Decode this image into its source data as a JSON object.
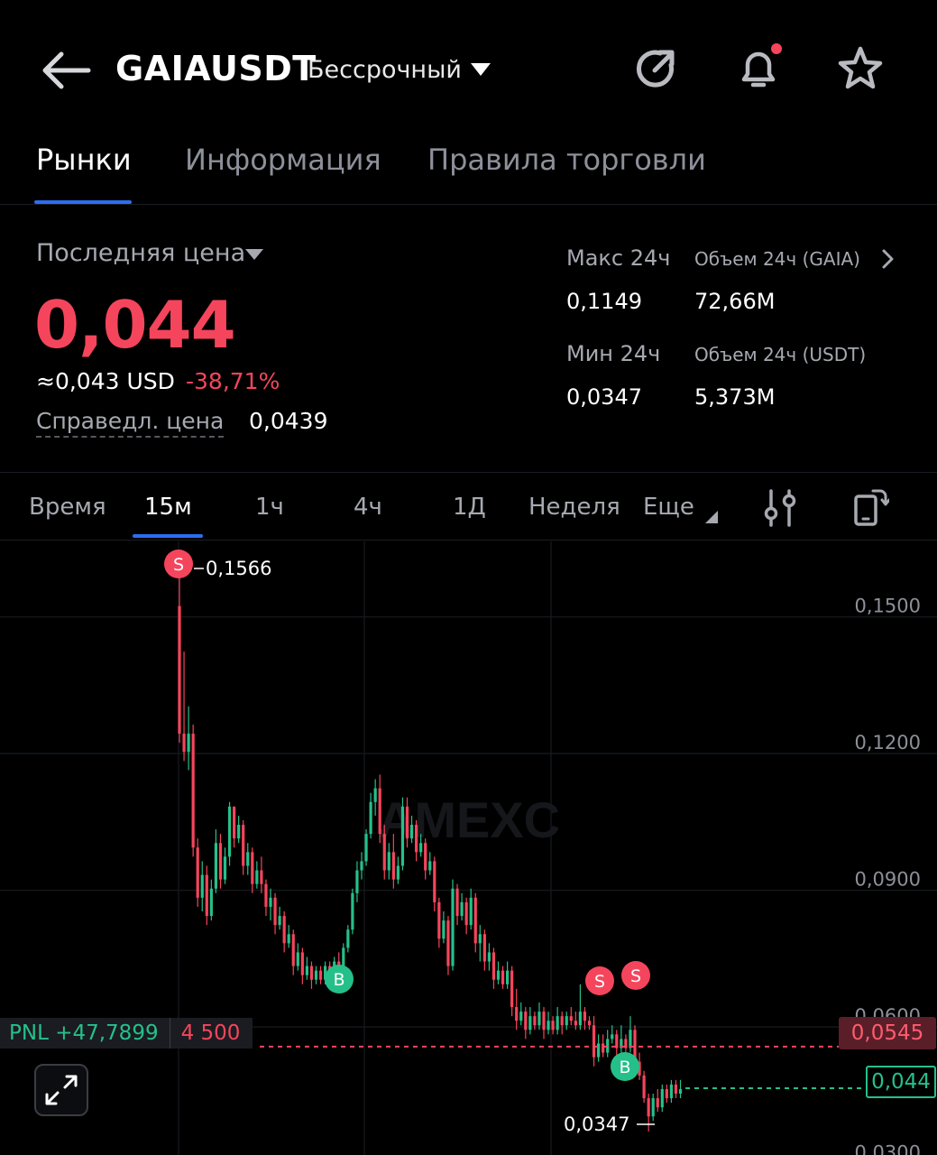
{
  "header": {
    "title": "GAIAUSDT",
    "subtitle": "Бессрочный"
  },
  "tabs": [
    {
      "label": "Рынки",
      "active": true
    },
    {
      "label": "Информация",
      "active": false
    },
    {
      "label": "Правила торговли",
      "active": false
    }
  ],
  "stats": {
    "last_price_label": "Последняя цена",
    "last_price": "0,044",
    "usd_equiv": "≈0,043 USD",
    "change": "-38,71%",
    "fair_label": "Справедл. цена",
    "fair_value": "0,0439",
    "high_label": "Макс 24ч",
    "high_value": "0,1149",
    "low_label": "Мин 24ч",
    "low_value": "0,0347",
    "vol_gaia_label": "Объем 24ч (GAIA)",
    "vol_gaia_value": "72,66M",
    "vol_usdt_label": "Объем 24ч  (USDT)",
    "vol_usdt_value": "5,373M"
  },
  "timeframes": [
    {
      "label": "Время",
      "active": false
    },
    {
      "label": "15м",
      "active": true
    },
    {
      "label": "1ч",
      "active": false
    },
    {
      "label": "4ч",
      "active": false
    },
    {
      "label": "1Д",
      "active": false
    },
    {
      "label": "Неделя",
      "active": false
    },
    {
      "label": "Еще",
      "active": false
    }
  ],
  "colors": {
    "up": "#25c08a",
    "down": "#f5455c",
    "accent": "#2c6ef2"
  },
  "chart_data": {
    "type": "candlestick",
    "y_ticks": [
      "0,1500",
      "0,1200",
      "0,0900",
      "0,0600",
      "0,0300"
    ],
    "y_tick_values": [
      0.15,
      0.12,
      0.09,
      0.06,
      0.03
    ],
    "ylim": [
      0.027,
      0.163
    ],
    "high_marker": {
      "label": "0,1566",
      "value": 0.1566
    },
    "low_marker": {
      "label": "0,0347",
      "value": 0.0347
    },
    "watermark": "AMEXC",
    "position_line": {
      "value": 0.0545,
      "label": "0,0545",
      "pnl_label": "PNL +47,7899",
      "qty_label": "4 500"
    },
    "current_price_line": {
      "value": 0.044,
      "label": "0,044"
    },
    "trade_markers": [
      {
        "side": "S",
        "index": 0
      },
      {
        "side": "B",
        "index": 35
      },
      {
        "side": "S",
        "index": 92
      },
      {
        "side": "S",
        "index": 101
      },
      {
        "side": "B",
        "index": 100
      }
    ],
    "candles": [
      [
        0.15,
        0.1566,
        0.12,
        0.122
      ],
      [
        0.122,
        0.14,
        0.116,
        0.118
      ],
      [
        0.118,
        0.128,
        0.114,
        0.122
      ],
      [
        0.122,
        0.124,
        0.095,
        0.097
      ],
      [
        0.097,
        0.099,
        0.084,
        0.086
      ],
      [
        0.086,
        0.094,
        0.083,
        0.091
      ],
      [
        0.091,
        0.093,
        0.08,
        0.082
      ],
      [
        0.082,
        0.09,
        0.081,
        0.088
      ],
      [
        0.088,
        0.101,
        0.087,
        0.098
      ],
      [
        0.098,
        0.1,
        0.088,
        0.09
      ],
      [
        0.09,
        0.097,
        0.089,
        0.095
      ],
      [
        0.095,
        0.107,
        0.093,
        0.106
      ],
      [
        0.106,
        0.106,
        0.097,
        0.099
      ],
      [
        0.099,
        0.104,
        0.098,
        0.102
      ],
      [
        0.102,
        0.103,
        0.091,
        0.093
      ],
      [
        0.093,
        0.098,
        0.091,
        0.096
      ],
      [
        0.096,
        0.097,
        0.087,
        0.089
      ],
      [
        0.089,
        0.094,
        0.088,
        0.092
      ],
      [
        0.092,
        0.095,
        0.087,
        0.089
      ],
      [
        0.089,
        0.09,
        0.082,
        0.084
      ],
      [
        0.084,
        0.088,
        0.081,
        0.086
      ],
      [
        0.086,
        0.087,
        0.078,
        0.08
      ],
      [
        0.08,
        0.084,
        0.079,
        0.082
      ],
      [
        0.082,
        0.083,
        0.074,
        0.076
      ],
      [
        0.076,
        0.08,
        0.075,
        0.078
      ],
      [
        0.078,
        0.079,
        0.069,
        0.071
      ],
      [
        0.071,
        0.076,
        0.07,
        0.074
      ],
      [
        0.074,
        0.075,
        0.067,
        0.069
      ],
      [
        0.069,
        0.073,
        0.068,
        0.071
      ],
      [
        0.071,
        0.072,
        0.066,
        0.068
      ],
      [
        0.068,
        0.071,
        0.067,
        0.07
      ],
      [
        0.07,
        0.071,
        0.067,
        0.068
      ],
      [
        0.068,
        0.072,
        0.067,
        0.071
      ],
      [
        0.071,
        0.072,
        0.068,
        0.069
      ],
      [
        0.069,
        0.073,
        0.068,
        0.072
      ],
      [
        0.072,
        0.074,
        0.069,
        0.07
      ],
      [
        0.07,
        0.076,
        0.069,
        0.075
      ],
      [
        0.075,
        0.08,
        0.074,
        0.079
      ],
      [
        0.079,
        0.088,
        0.078,
        0.087
      ],
      [
        0.087,
        0.094,
        0.085,
        0.092
      ],
      [
        0.092,
        0.096,
        0.09,
        0.094
      ],
      [
        0.094,
        0.101,
        0.093,
        0.1
      ],
      [
        0.1,
        0.109,
        0.099,
        0.107
      ],
      [
        0.107,
        0.112,
        0.104,
        0.11
      ],
      [
        0.11,
        0.113,
        0.098,
        0.1
      ],
      [
        0.1,
        0.102,
        0.09,
        0.092
      ],
      [
        0.092,
        0.098,
        0.09,
        0.096
      ],
      [
        0.096,
        0.1,
        0.088,
        0.09
      ],
      [
        0.09,
        0.095,
        0.089,
        0.093
      ],
      [
        0.093,
        0.108,
        0.092,
        0.106
      ],
      [
        0.106,
        0.108,
        0.097,
        0.099
      ],
      [
        0.099,
        0.104,
        0.098,
        0.102
      ],
      [
        0.102,
        0.103,
        0.094,
        0.096
      ],
      [
        0.096,
        0.1,
        0.095,
        0.098
      ],
      [
        0.098,
        0.099,
        0.09,
        0.092
      ],
      [
        0.092,
        0.096,
        0.091,
        0.094
      ],
      [
        0.094,
        0.095,
        0.083,
        0.085
      ],
      [
        0.085,
        0.086,
        0.075,
        0.077
      ],
      [
        0.077,
        0.083,
        0.076,
        0.081
      ],
      [
        0.081,
        0.082,
        0.069,
        0.071
      ],
      [
        0.071,
        0.09,
        0.07,
        0.088
      ],
      [
        0.088,
        0.089,
        0.08,
        0.082
      ],
      [
        0.082,
        0.087,
        0.081,
        0.085
      ],
      [
        0.085,
        0.086,
        0.078,
        0.08
      ],
      [
        0.08,
        0.088,
        0.079,
        0.086
      ],
      [
        0.086,
        0.087,
        0.074,
        0.076
      ],
      [
        0.076,
        0.08,
        0.072,
        0.078
      ],
      [
        0.078,
        0.079,
        0.07,
        0.072
      ],
      [
        0.072,
        0.076,
        0.07,
        0.074
      ],
      [
        0.074,
        0.075,
        0.066,
        0.068
      ],
      [
        0.068,
        0.072,
        0.067,
        0.07
      ],
      [
        0.07,
        0.071,
        0.066,
        0.067
      ],
      [
        0.067,
        0.072,
        0.066,
        0.07
      ],
      [
        0.07,
        0.071,
        0.06,
        0.062
      ],
      [
        0.062,
        0.066,
        0.057,
        0.059
      ],
      [
        0.059,
        0.063,
        0.058,
        0.061
      ],
      [
        0.061,
        0.062,
        0.055,
        0.057
      ],
      [
        0.057,
        0.062,
        0.056,
        0.06
      ],
      [
        0.06,
        0.061,
        0.057,
        0.058
      ],
      [
        0.058,
        0.063,
        0.057,
        0.061
      ],
      [
        0.061,
        0.062,
        0.055,
        0.057
      ],
      [
        0.057,
        0.061,
        0.056,
        0.059
      ],
      [
        0.059,
        0.06,
        0.056,
        0.057
      ],
      [
        0.057,
        0.062,
        0.056,
        0.06
      ],
      [
        0.06,
        0.061,
        0.056,
        0.058
      ],
      [
        0.058,
        0.061,
        0.057,
        0.06
      ],
      [
        0.06,
        0.062,
        0.058,
        0.059
      ],
      [
        0.059,
        0.061,
        0.057,
        0.058
      ],
      [
        0.058,
        0.067,
        0.057,
        0.061
      ],
      [
        0.061,
        0.062,
        0.057,
        0.059
      ],
      [
        0.059,
        0.06,
        0.057,
        0.058
      ],
      [
        0.058,
        0.06,
        0.049,
        0.051
      ],
      [
        0.051,
        0.056,
        0.05,
        0.054
      ],
      [
        0.054,
        0.056,
        0.051,
        0.052
      ],
      [
        0.052,
        0.057,
        0.051,
        0.055
      ],
      [
        0.055,
        0.058,
        0.054,
        0.056
      ],
      [
        0.056,
        0.057,
        0.051,
        0.053
      ],
      [
        0.053,
        0.058,
        0.052,
        0.055
      ],
      [
        0.055,
        0.056,
        0.052,
        0.053
      ],
      [
        0.053,
        0.06,
        0.052,
        0.057
      ],
      [
        0.057,
        0.058,
        0.048,
        0.05
      ],
      [
        0.05,
        0.052,
        0.046,
        0.047
      ],
      [
        0.047,
        0.048,
        0.041,
        0.042
      ],
      [
        0.042,
        0.043,
        0.0347,
        0.038
      ],
      [
        0.038,
        0.043,
        0.037,
        0.042
      ],
      [
        0.042,
        0.044,
        0.039,
        0.04
      ],
      [
        0.04,
        0.045,
        0.039,
        0.044
      ],
      [
        0.044,
        0.045,
        0.041,
        0.042
      ],
      [
        0.042,
        0.046,
        0.041,
        0.045
      ],
      [
        0.045,
        0.046,
        0.042,
        0.043
      ],
      [
        0.043,
        0.046,
        0.042,
        0.044
      ]
    ]
  }
}
